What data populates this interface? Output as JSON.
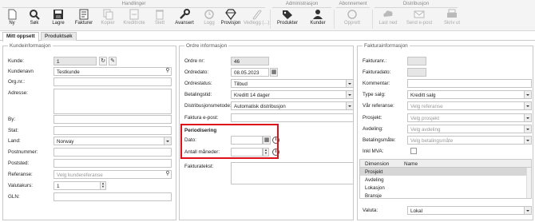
{
  "toolbar": {
    "groups": {
      "handlinger": "Handlinger",
      "administrasjon": "Administrasjon",
      "abonnement": "Abonnement",
      "distribusjon": "Distribusjon"
    },
    "buttons": {
      "ny": "Ny",
      "sok": "Søk",
      "lagre": "Lagre",
      "fakturer": "Fakturer",
      "kopier": "Kopier",
      "kreditnota": "Kreditnote",
      "slett": "Slett",
      "avansert": "Avansert",
      "logg": "Logg",
      "provisjon": "Provisjon",
      "vedlegg": "Vedlegg (...)",
      "produkter": "Produkter",
      "kunder": "Kunder",
      "opprett": "Opprett",
      "last_ned": "Last ned",
      "send_epost": "Send e-post",
      "skriv_ut": "Skriv ut"
    }
  },
  "tabs": [
    "Mitt oppsett",
    "Produktsøk"
  ],
  "kunde": {
    "title": "Kundeinformasjon",
    "labels": {
      "kunde": "Kunde:",
      "kundenavn": "Kundenavn",
      "orgnr": "Org.nr.:",
      "adresse": "Adresse:",
      "by": "By:",
      "stat": "Stat:",
      "land": "Land:",
      "postnummer": "Postnummer:",
      "poststed": "Poststed:",
      "referanse": "Referanse:",
      "valutakurs": "Valutakurs:",
      "gln": "GLN:"
    },
    "values": {
      "kunde": "1",
      "kundenavn": "Testkunde",
      "land": "Norway",
      "valutakurs": "1"
    },
    "placeholders": {
      "referanse": "Velg kundereferanse"
    }
  },
  "ordre": {
    "title": "Ordre informasjon",
    "labels": {
      "ordrenr": "Ordre nr:",
      "ordredato": "Ordredato:",
      "ordrestatus": "Ordrestatus:",
      "betalingstid": "Betalingstid:",
      "distribusjon": "Distribusjonsmetode:",
      "faktura_epost": "Faktura e-post:",
      "periodisering": "Periodisering",
      "dato": "Dato:",
      "antall_maneder": "Antall måneder:",
      "fakturatekst": "Fakturatekst:"
    },
    "values": {
      "ordrenr": "46",
      "ordredato": "08.05.2023",
      "ordrestatus": "Tilbud",
      "betalingstid": "Kreditt 14 dager",
      "distribusjon": "Automatisk distribusjon"
    }
  },
  "faktura": {
    "title": "Fakturainformasjon",
    "labels": {
      "fakturanr": "Fakturanr.:",
      "fakturadato": "Fakturadato:",
      "kommentar": "Kommentar:",
      "type_salg": "Type salg:",
      "var_referanse": "Vår referanse:",
      "prosjekt": "Prosjekt:",
      "avdeling": "Avdeling:",
      "betalingsmate": "Betalingsmåte:",
      "inkl_mva": "Inkl MVA:",
      "valuta": "Valuta:"
    },
    "values": {
      "type_salg": "Kreditt salg",
      "valuta": "Lokal"
    },
    "placeholders": {
      "var_referanse": "Velg referanse",
      "prosjekt": "Velg prosjekt",
      "avdeling": "Velg avdeling",
      "betalingsmate": "Velg betalingsmåte"
    },
    "dimension_table": {
      "headers": [
        "Dimension",
        "Name"
      ],
      "rows": [
        "Prosjekt",
        "Avdeling",
        "Lokasjon",
        "Bransje"
      ]
    }
  },
  "colors": {
    "highlight": "#e0101a",
    "toolbar_bg": "#f4f4f4"
  }
}
